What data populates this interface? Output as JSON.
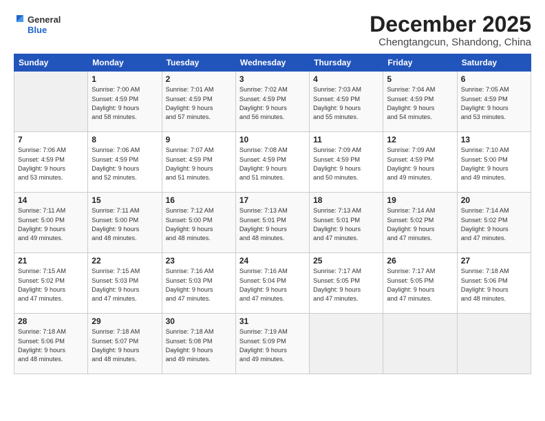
{
  "header": {
    "logo_general": "General",
    "logo_blue": "Blue",
    "month_title": "December 2025",
    "subtitle": "Chengtangcun, Shandong, China"
  },
  "days_of_week": [
    "Sunday",
    "Monday",
    "Tuesday",
    "Wednesday",
    "Thursday",
    "Friday",
    "Saturday"
  ],
  "weeks": [
    [
      {
        "day": "",
        "info": ""
      },
      {
        "day": "1",
        "info": "Sunrise: 7:00 AM\nSunset: 4:59 PM\nDaylight: 9 hours\nand 58 minutes."
      },
      {
        "day": "2",
        "info": "Sunrise: 7:01 AM\nSunset: 4:59 PM\nDaylight: 9 hours\nand 57 minutes."
      },
      {
        "day": "3",
        "info": "Sunrise: 7:02 AM\nSunset: 4:59 PM\nDaylight: 9 hours\nand 56 minutes."
      },
      {
        "day": "4",
        "info": "Sunrise: 7:03 AM\nSunset: 4:59 PM\nDaylight: 9 hours\nand 55 minutes."
      },
      {
        "day": "5",
        "info": "Sunrise: 7:04 AM\nSunset: 4:59 PM\nDaylight: 9 hours\nand 54 minutes."
      },
      {
        "day": "6",
        "info": "Sunrise: 7:05 AM\nSunset: 4:59 PM\nDaylight: 9 hours\nand 53 minutes."
      }
    ],
    [
      {
        "day": "7",
        "info": "Sunrise: 7:06 AM\nSunset: 4:59 PM\nDaylight: 9 hours\nand 53 minutes."
      },
      {
        "day": "8",
        "info": "Sunrise: 7:06 AM\nSunset: 4:59 PM\nDaylight: 9 hours\nand 52 minutes."
      },
      {
        "day": "9",
        "info": "Sunrise: 7:07 AM\nSunset: 4:59 PM\nDaylight: 9 hours\nand 51 minutes."
      },
      {
        "day": "10",
        "info": "Sunrise: 7:08 AM\nSunset: 4:59 PM\nDaylight: 9 hours\nand 51 minutes."
      },
      {
        "day": "11",
        "info": "Sunrise: 7:09 AM\nSunset: 4:59 PM\nDaylight: 9 hours\nand 50 minutes."
      },
      {
        "day": "12",
        "info": "Sunrise: 7:09 AM\nSunset: 4:59 PM\nDaylight: 9 hours\nand 49 minutes."
      },
      {
        "day": "13",
        "info": "Sunrise: 7:10 AM\nSunset: 5:00 PM\nDaylight: 9 hours\nand 49 minutes."
      }
    ],
    [
      {
        "day": "14",
        "info": "Sunrise: 7:11 AM\nSunset: 5:00 PM\nDaylight: 9 hours\nand 49 minutes."
      },
      {
        "day": "15",
        "info": "Sunrise: 7:11 AM\nSunset: 5:00 PM\nDaylight: 9 hours\nand 48 minutes."
      },
      {
        "day": "16",
        "info": "Sunrise: 7:12 AM\nSunset: 5:00 PM\nDaylight: 9 hours\nand 48 minutes."
      },
      {
        "day": "17",
        "info": "Sunrise: 7:13 AM\nSunset: 5:01 PM\nDaylight: 9 hours\nand 48 minutes."
      },
      {
        "day": "18",
        "info": "Sunrise: 7:13 AM\nSunset: 5:01 PM\nDaylight: 9 hours\nand 47 minutes."
      },
      {
        "day": "19",
        "info": "Sunrise: 7:14 AM\nSunset: 5:02 PM\nDaylight: 9 hours\nand 47 minutes."
      },
      {
        "day": "20",
        "info": "Sunrise: 7:14 AM\nSunset: 5:02 PM\nDaylight: 9 hours\nand 47 minutes."
      }
    ],
    [
      {
        "day": "21",
        "info": "Sunrise: 7:15 AM\nSunset: 5:02 PM\nDaylight: 9 hours\nand 47 minutes."
      },
      {
        "day": "22",
        "info": "Sunrise: 7:15 AM\nSunset: 5:03 PM\nDaylight: 9 hours\nand 47 minutes."
      },
      {
        "day": "23",
        "info": "Sunrise: 7:16 AM\nSunset: 5:03 PM\nDaylight: 9 hours\nand 47 minutes."
      },
      {
        "day": "24",
        "info": "Sunrise: 7:16 AM\nSunset: 5:04 PM\nDaylight: 9 hours\nand 47 minutes."
      },
      {
        "day": "25",
        "info": "Sunrise: 7:17 AM\nSunset: 5:05 PM\nDaylight: 9 hours\nand 47 minutes."
      },
      {
        "day": "26",
        "info": "Sunrise: 7:17 AM\nSunset: 5:05 PM\nDaylight: 9 hours\nand 47 minutes."
      },
      {
        "day": "27",
        "info": "Sunrise: 7:18 AM\nSunset: 5:06 PM\nDaylight: 9 hours\nand 48 minutes."
      }
    ],
    [
      {
        "day": "28",
        "info": "Sunrise: 7:18 AM\nSunset: 5:06 PM\nDaylight: 9 hours\nand 48 minutes."
      },
      {
        "day": "29",
        "info": "Sunrise: 7:18 AM\nSunset: 5:07 PM\nDaylight: 9 hours\nand 48 minutes."
      },
      {
        "day": "30",
        "info": "Sunrise: 7:18 AM\nSunset: 5:08 PM\nDaylight: 9 hours\nand 49 minutes."
      },
      {
        "day": "31",
        "info": "Sunrise: 7:19 AM\nSunset: 5:09 PM\nDaylight: 9 hours\nand 49 minutes."
      },
      {
        "day": "",
        "info": ""
      },
      {
        "day": "",
        "info": ""
      },
      {
        "day": "",
        "info": ""
      }
    ]
  ]
}
